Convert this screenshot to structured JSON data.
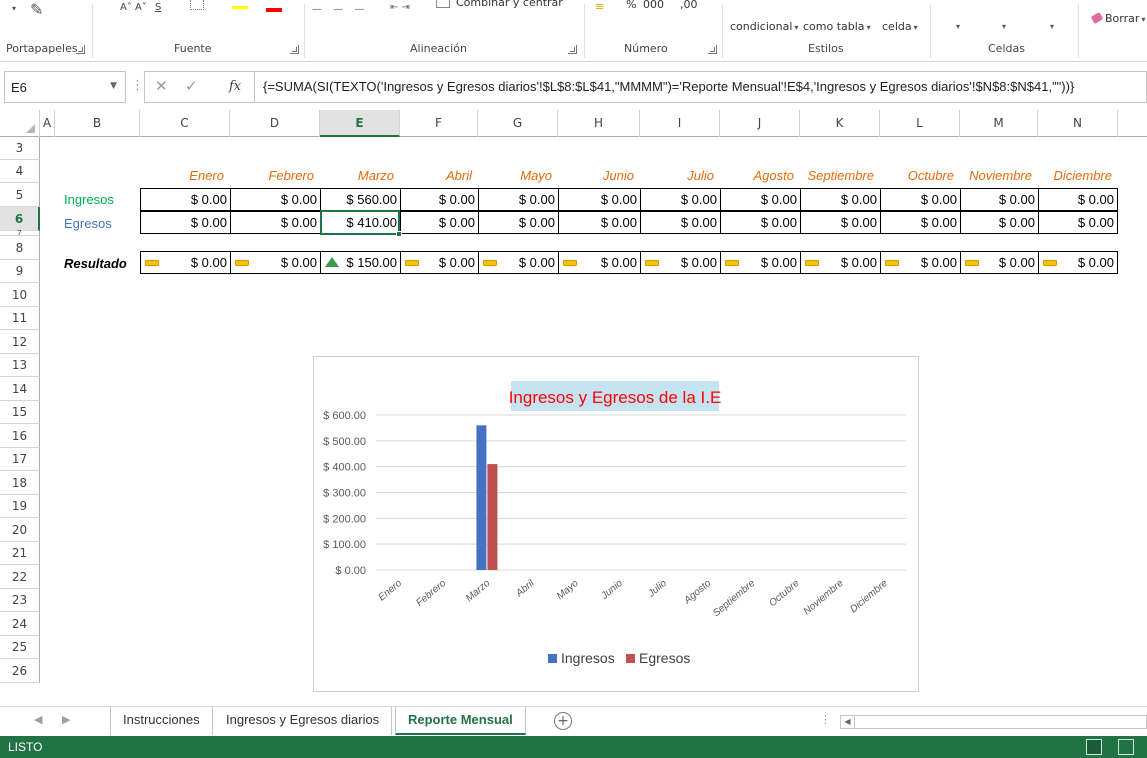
{
  "ribbon": {
    "groups": [
      "Portapapeles",
      "Fuente",
      "Alineación",
      "Número",
      "Estilos",
      "Celdas"
    ],
    "merge_center": "Combinar y centrar",
    "percent_sign": "%",
    "thousands_sep": "000",
    "decimals": ",00",
    "cond_format": "condicional",
    "table_format": "como tabla",
    "cell_styles": "celda",
    "clear": "Borrar"
  },
  "formula_bar": {
    "name_box": "E6",
    "formula": "{=SUMA(SI(TEXTO('Ingresos y Egresos diarios'!$L$8:$L$41,\"MMMM\")='Reporte Mensual'!E$4,'Ingresos y Egresos diarios'!$N$8:$N$41,\"\"))}"
  },
  "grid": {
    "columns": [
      "A",
      "B",
      "C",
      "D",
      "E",
      "F",
      "G",
      "H",
      "I",
      "J",
      "K",
      "L",
      "M",
      "N"
    ],
    "rows": [
      "3",
      "4",
      "5",
      "6",
      "7",
      "8",
      "9",
      "10",
      "11",
      "12",
      "13",
      "14",
      "15",
      "16",
      "17",
      "18",
      "19",
      "20",
      "21",
      "22",
      "23",
      "24",
      "25",
      "26"
    ],
    "months": [
      "Enero",
      "Febrero",
      "Marzo",
      "Abril",
      "Mayo",
      "Junio",
      "Julio",
      "Agosto",
      "Septiembre",
      "Octubre",
      "Noviembre",
      "Diciembre"
    ],
    "label_ingresos": "Ingresos",
    "label_egresos": "Egresos",
    "label_resultado": "Resultado",
    "ingresos": [
      "$ 0.00",
      "$ 0.00",
      "$ 560.00",
      "$ 0.00",
      "$ 0.00",
      "$ 0.00",
      "$ 0.00",
      "$ 0.00",
      "$ 0.00",
      "$ 0.00",
      "$ 0.00",
      "$ 0.00"
    ],
    "egresos": [
      "$ 0.00",
      "$ 0.00",
      "$ 410.00",
      "$ 0.00",
      "$ 0.00",
      "$ 0.00",
      "$ 0.00",
      "$ 0.00",
      "$ 0.00",
      "$ 0.00",
      "$ 0.00",
      "$ 0.00"
    ],
    "resultado": [
      "$ 0.00",
      "$ 0.00",
      "$ 150.00",
      "$ 0.00",
      "$ 0.00",
      "$ 0.00",
      "$ 0.00",
      "$ 0.00",
      "$ 0.00",
      "$ 0.00",
      "$ 0.00",
      "$ 0.00"
    ],
    "resultado_icons": [
      "flat",
      "flat",
      "up",
      "flat",
      "flat",
      "flat",
      "flat",
      "flat",
      "flat",
      "flat",
      "flat",
      "flat"
    ]
  },
  "colors": {
    "excel_green": "#217346",
    "month_orange": "#e46c0a",
    "ingresos_green": "#00b050",
    "egresos_blue": "#4472c4",
    "chart_title_red": "#ff0000",
    "chart_title_bg": "#c5e3f0"
  },
  "chart_data": {
    "type": "bar",
    "title": "Ingresos y Egresos de la I.E",
    "categories": [
      "Enero",
      "Febrero",
      "Marzo",
      "Abril",
      "Mayo",
      "Junio",
      "Julio",
      "Agosto",
      "Septiembre",
      "Octubre",
      "Noviembre",
      "Diciembre"
    ],
    "series": [
      {
        "name": "Ingresos",
        "values": [
          0,
          0,
          560,
          0,
          0,
          0,
          0,
          0,
          0,
          0,
          0,
          0
        ],
        "color": "#4472c4"
      },
      {
        "name": "Egresos",
        "values": [
          0,
          0,
          410,
          0,
          0,
          0,
          0,
          0,
          0,
          0,
          0,
          0
        ],
        "color": "#c0504d"
      }
    ],
    "yticks": [
      "$ 0.00",
      "$ 100.00",
      "$ 200.00",
      "$ 300.00",
      "$ 400.00",
      "$ 500.00",
      "$ 600.00"
    ],
    "ylim": [
      0,
      600
    ],
    "grid": true,
    "legend": "bottom"
  },
  "sheets": {
    "tabs": [
      "Instrucciones",
      "Ingresos y Egresos diarios",
      "Reporte Mensual"
    ],
    "active": "Reporte Mensual"
  },
  "status": {
    "text": "LISTO"
  }
}
